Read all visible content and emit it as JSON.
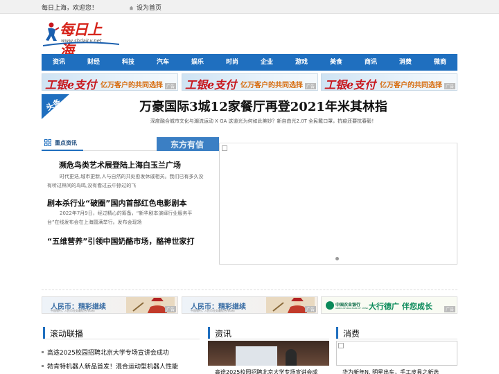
{
  "topbar": {
    "welcome": "每日上海，欢迎您！",
    "set_home": "设为首页"
  },
  "logo": {
    "name": "每日上海",
    "url": "www.shdaiLy.net"
  },
  "nav": [
    "资讯",
    "财经",
    "科技",
    "汽车",
    "娱乐",
    "时尚",
    "企业",
    "游戏",
    "美食",
    "商讯",
    "消费",
    "微商"
  ],
  "banner_ads": [
    {
      "brand": "工银e支付",
      "slogan": "亿万客户的共同选择",
      "tag": "广告"
    },
    {
      "brand": "工银e支付",
      "slogan": "亿万客户的共同选择",
      "tag": "广告"
    },
    {
      "brand": "工银e支付",
      "slogan": "亿万客户的共同选择",
      "tag": "广告"
    }
  ],
  "headline": {
    "tag": "头条",
    "title": "万豪国际3城12家餐厅再登2021年米其林指",
    "subtitle": "深度融合城市文化与潮流运动 X GA   这道光为何如此美妙？新自由光2.0T   全民戴口罩，抗疫还要抗春毅！"
  },
  "focus": {
    "label": "重点资讯",
    "overlay": "东方有信",
    "items": [
      {
        "title": "濒危鸟类艺术展登陆上海白玉兰广场",
        "desc": "时代更迭,城市更新,人与自然的共处愈发休戚相关。我们已有多久没有听过林间的鸟鸣,没有看过云中掠过的飞"
      },
      {
        "title": "剧本杀行业“破圈”国内首部红色电影剧本",
        "desc": "2022年7月9日，经过精心的筹备，“新华剧本演绎行业服务平台”在线发布会在上海圆满举行。发布会现场"
      },
      {
        "title": "“五维营养”引领中国奶酪市场，酪神世家打",
        "desc": ""
      }
    ]
  },
  "mid_ads": [
    {
      "text": "人民币：精彩继续",
      "small": "中国银行。人民币业务最佳合作伙伴",
      "tag": "广告"
    },
    {
      "text": "人民币：精彩继续",
      "small": "中国银行。人民币业务最佳合作伙伴",
      "tag": "广告"
    },
    {
      "bank": "中国农业银行",
      "bank_en": "AGRICULTURAL BANK OF CHINA",
      "slogan": "大行德广 伴您成长",
      "tag": "广告"
    }
  ],
  "sections": {
    "rolling": {
      "title": "滚动联播",
      "items": [
        "高途2025校园招聘北京大学专场宣讲会成功",
        "勃肯特机器人新品首发！混合运动型机器人性能"
      ]
    },
    "news": {
      "title": "资讯",
      "caption": "高途2025校园招聘北京大学专场宣讲会成"
    },
    "consume": {
      "title": "消费",
      "caption": "华为新年N. 明星出车，手工皮具之新选"
    }
  },
  "colors": {
    "nav_blue": "#1f6fbf",
    "brand_red": "#d6231a",
    "headline_tag": "#1f6fbf"
  }
}
